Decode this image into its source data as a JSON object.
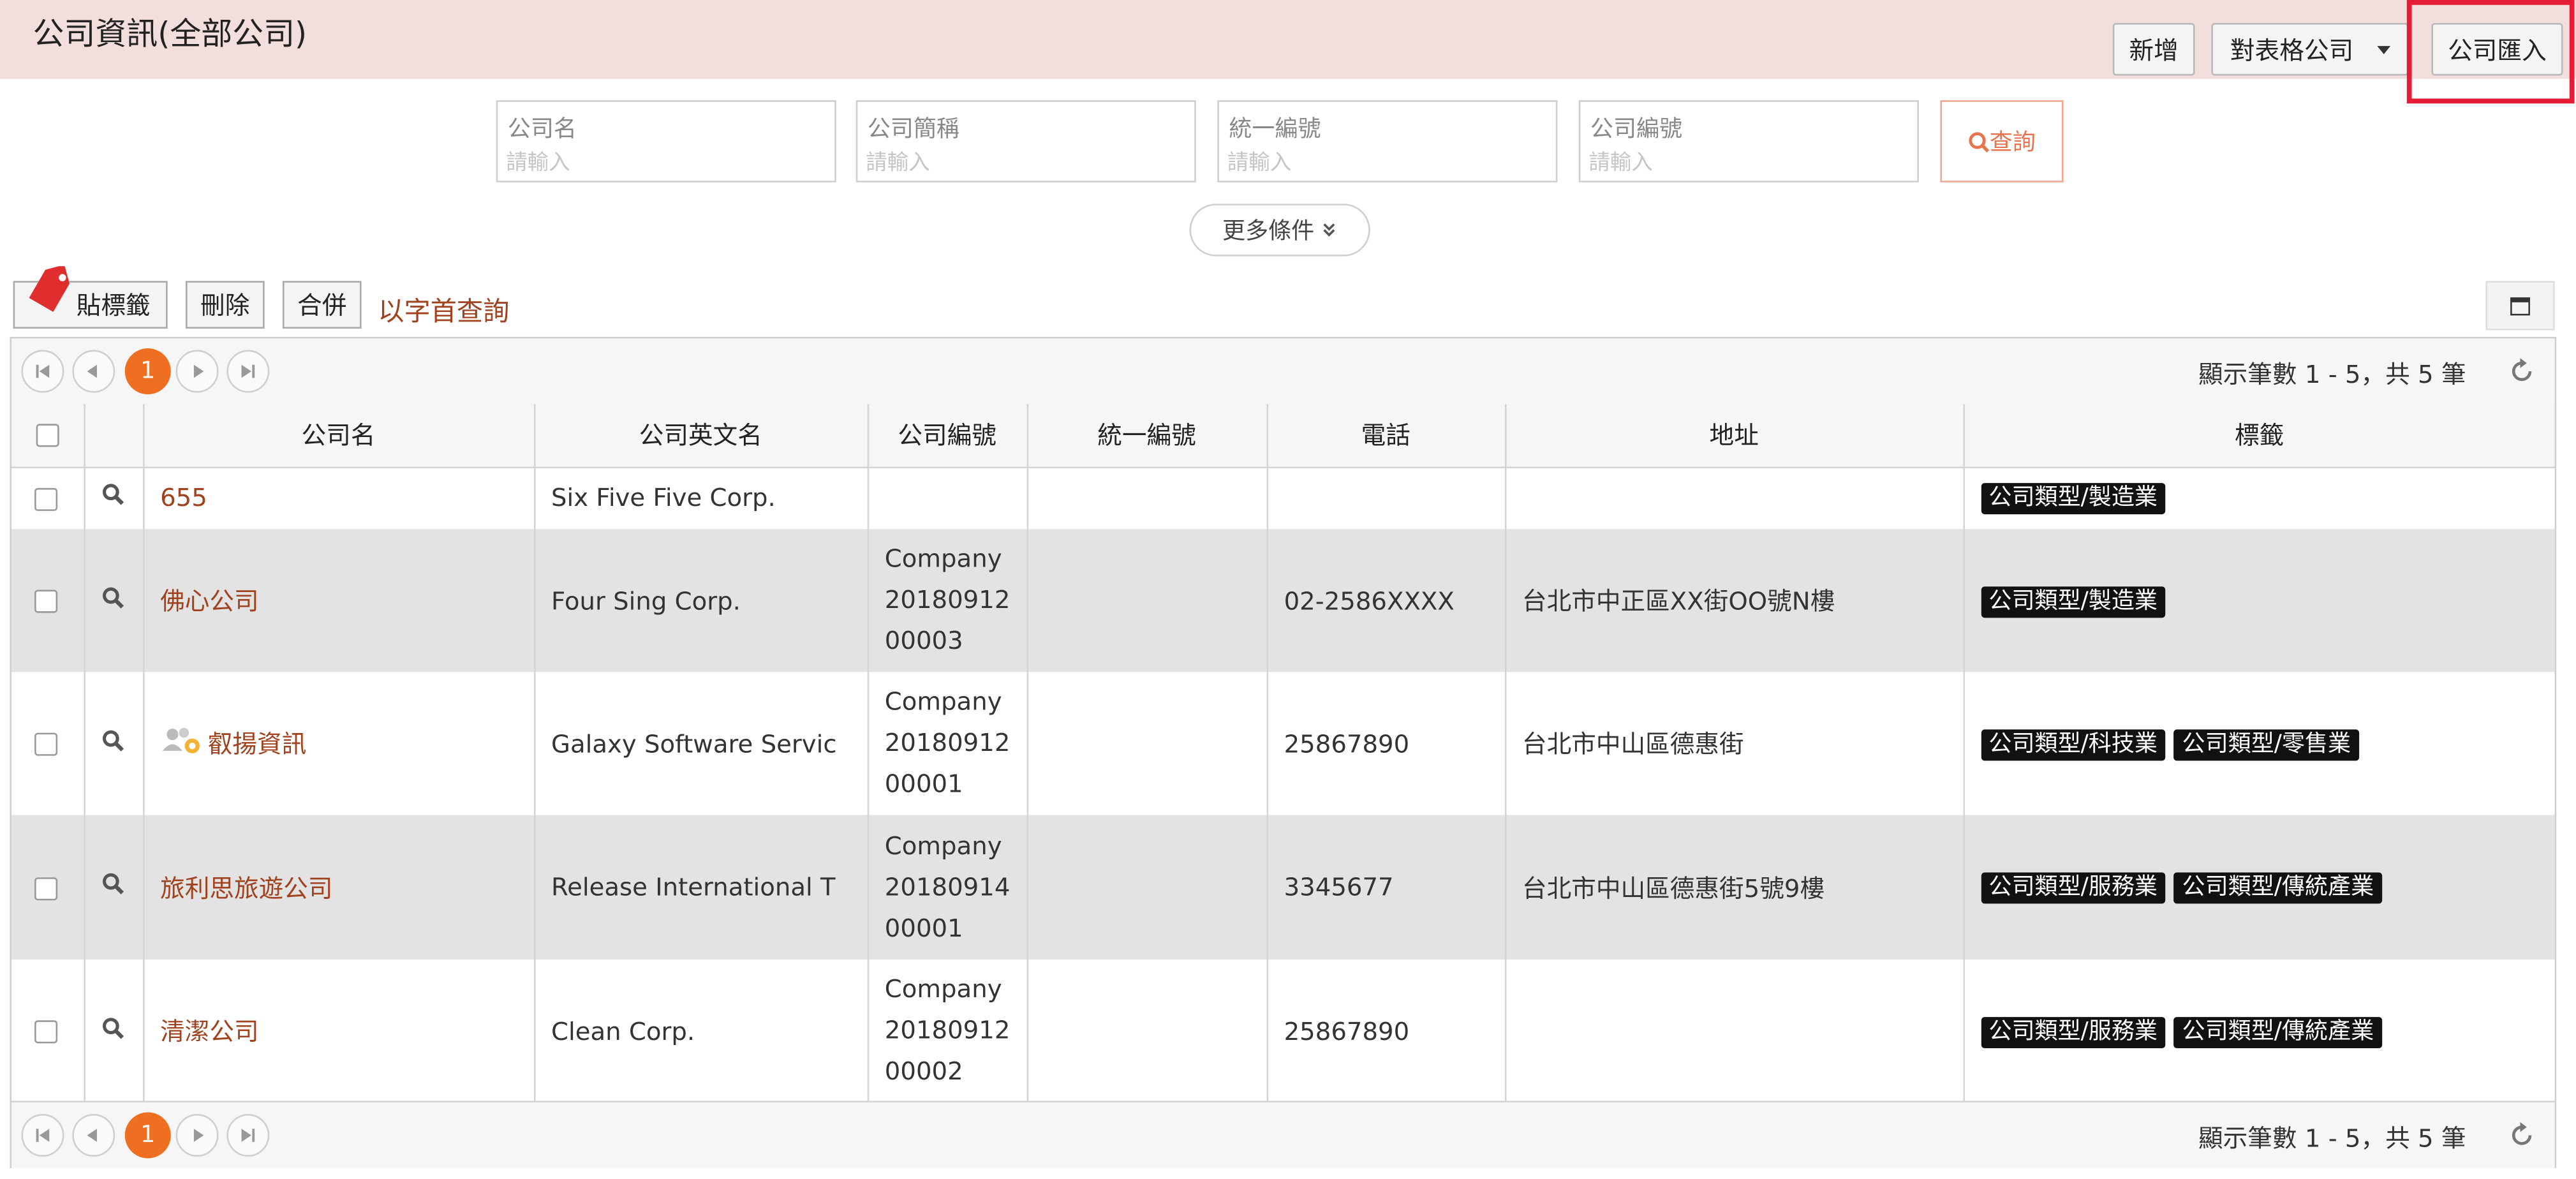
{
  "header": {
    "title": "公司資訊(全部公司)",
    "add_label": "新增",
    "export_label": "對表格公司",
    "import_label": "公司匯入"
  },
  "search": {
    "fields": [
      {
        "label": "公司名",
        "placeholder": "請輸入"
      },
      {
        "label": "公司簡稱",
        "placeholder": "請輸入"
      },
      {
        "label": "統一編號",
        "placeholder": "請輸入"
      },
      {
        "label": "公司編號",
        "placeholder": "請輸入"
      }
    ],
    "query_label": "查詢",
    "more_label": "更多條件"
  },
  "toolbar": {
    "tag_label": "貼標籤",
    "delete_label": "刪除",
    "merge_label": "合併",
    "first_letter_label": "以字首查詢"
  },
  "pager": {
    "current_page": "1",
    "info": "顯示筆數 1 - 5，共 5 筆"
  },
  "table": {
    "columns": [
      "公司名",
      "公司英文名",
      "公司編號",
      "統一編號",
      "電話",
      "地址",
      "標籤"
    ],
    "rows": [
      {
        "name": "655",
        "english_name": "Six Five Five Corp.",
        "code": "",
        "tax_id": "",
        "phone": "",
        "address": "",
        "tags": [
          "公司類型/製造業"
        ]
      },
      {
        "name": "佛心公司",
        "english_name": "Four Sing Corp.",
        "code": "Company 20180912 00003",
        "tax_id": "",
        "phone": "02-2586XXXX",
        "address": "台北市中正區XX街OO號N樓",
        "tags": [
          "公司類型/製造業"
        ]
      },
      {
        "name": "叡揚資訊",
        "english_name": "Galaxy Software Servic",
        "code": "Company 20180912 00001",
        "tax_id": "",
        "phone": "25867890",
        "address": "台北市中山區德惠街",
        "tags": [
          "公司類型/科技業",
          "公司類型/零售業"
        ]
      },
      {
        "name": "旅利思旅遊公司",
        "english_name": "Release International T",
        "code": "Company 20180914 00001",
        "tax_id": "",
        "phone": "3345677",
        "address": "台北市中山區德惠街5號9樓",
        "tags": [
          "公司類型/服務業",
          "公司類型/傳統產業"
        ]
      },
      {
        "name": "清潔公司",
        "english_name": "Clean Corp.",
        "code": "Company 20180912 00002",
        "tax_id": "",
        "phone": "25867890",
        "address": "",
        "tags": [
          "公司類型/服務業",
          "公司類型/傳統產業"
        ]
      }
    ]
  },
  "colors": {
    "header_bg": "#f1dedd",
    "accent": "#ee6f22",
    "link": "#a1421f",
    "highlight": "#e41c34"
  }
}
